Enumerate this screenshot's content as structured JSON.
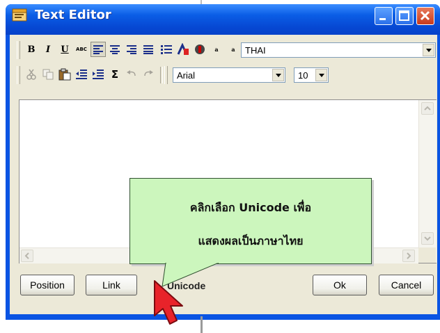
{
  "window": {
    "title": "Text Editor"
  },
  "toolbar1": {
    "bold": "B",
    "italic": "I",
    "underline": "U",
    "spell": "ABC",
    "size_up": "a",
    "size_down": "a",
    "charset_value": "THAI"
  },
  "toolbar2": {
    "sum": "Σ",
    "font_value": "Arial",
    "size_value": "10"
  },
  "buttons": {
    "position": "Position",
    "link": "Link",
    "unicode": "Unicode",
    "ok": "Ok",
    "cancel": "Cancel"
  },
  "callout": {
    "line1": "คลิกเลือก Unicode เพื่อ",
    "line2": "แสดงผลเป็นภาษาไทย"
  },
  "colors": {
    "titlebar": "#0648d3",
    "callout": "#ccf6bd",
    "cursor": "#e8232a"
  }
}
